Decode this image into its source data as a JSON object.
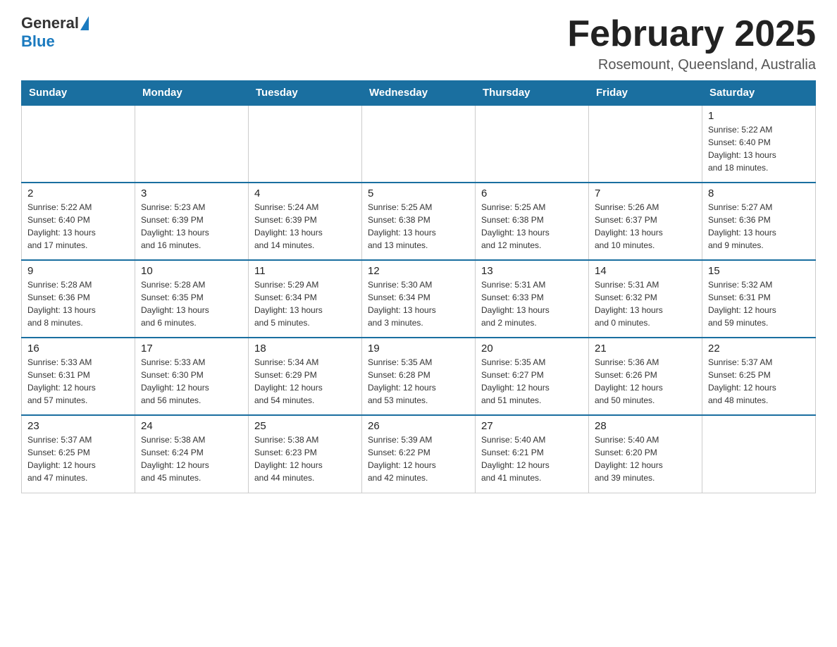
{
  "header": {
    "logo_general": "General",
    "logo_blue": "Blue",
    "month_title": "February 2025",
    "location": "Rosemount, Queensland, Australia"
  },
  "weekdays": [
    "Sunday",
    "Monday",
    "Tuesday",
    "Wednesday",
    "Thursday",
    "Friday",
    "Saturday"
  ],
  "weeks": [
    [
      {
        "day": "",
        "info": ""
      },
      {
        "day": "",
        "info": ""
      },
      {
        "day": "",
        "info": ""
      },
      {
        "day": "",
        "info": ""
      },
      {
        "day": "",
        "info": ""
      },
      {
        "day": "",
        "info": ""
      },
      {
        "day": "1",
        "info": "Sunrise: 5:22 AM\nSunset: 6:40 PM\nDaylight: 13 hours\nand 18 minutes."
      }
    ],
    [
      {
        "day": "2",
        "info": "Sunrise: 5:22 AM\nSunset: 6:40 PM\nDaylight: 13 hours\nand 17 minutes."
      },
      {
        "day": "3",
        "info": "Sunrise: 5:23 AM\nSunset: 6:39 PM\nDaylight: 13 hours\nand 16 minutes."
      },
      {
        "day": "4",
        "info": "Sunrise: 5:24 AM\nSunset: 6:39 PM\nDaylight: 13 hours\nand 14 minutes."
      },
      {
        "day": "5",
        "info": "Sunrise: 5:25 AM\nSunset: 6:38 PM\nDaylight: 13 hours\nand 13 minutes."
      },
      {
        "day": "6",
        "info": "Sunrise: 5:25 AM\nSunset: 6:38 PM\nDaylight: 13 hours\nand 12 minutes."
      },
      {
        "day": "7",
        "info": "Sunrise: 5:26 AM\nSunset: 6:37 PM\nDaylight: 13 hours\nand 10 minutes."
      },
      {
        "day": "8",
        "info": "Sunrise: 5:27 AM\nSunset: 6:36 PM\nDaylight: 13 hours\nand 9 minutes."
      }
    ],
    [
      {
        "day": "9",
        "info": "Sunrise: 5:28 AM\nSunset: 6:36 PM\nDaylight: 13 hours\nand 8 minutes."
      },
      {
        "day": "10",
        "info": "Sunrise: 5:28 AM\nSunset: 6:35 PM\nDaylight: 13 hours\nand 6 minutes."
      },
      {
        "day": "11",
        "info": "Sunrise: 5:29 AM\nSunset: 6:34 PM\nDaylight: 13 hours\nand 5 minutes."
      },
      {
        "day": "12",
        "info": "Sunrise: 5:30 AM\nSunset: 6:34 PM\nDaylight: 13 hours\nand 3 minutes."
      },
      {
        "day": "13",
        "info": "Sunrise: 5:31 AM\nSunset: 6:33 PM\nDaylight: 13 hours\nand 2 minutes."
      },
      {
        "day": "14",
        "info": "Sunrise: 5:31 AM\nSunset: 6:32 PM\nDaylight: 13 hours\nand 0 minutes."
      },
      {
        "day": "15",
        "info": "Sunrise: 5:32 AM\nSunset: 6:31 PM\nDaylight: 12 hours\nand 59 minutes."
      }
    ],
    [
      {
        "day": "16",
        "info": "Sunrise: 5:33 AM\nSunset: 6:31 PM\nDaylight: 12 hours\nand 57 minutes."
      },
      {
        "day": "17",
        "info": "Sunrise: 5:33 AM\nSunset: 6:30 PM\nDaylight: 12 hours\nand 56 minutes."
      },
      {
        "day": "18",
        "info": "Sunrise: 5:34 AM\nSunset: 6:29 PM\nDaylight: 12 hours\nand 54 minutes."
      },
      {
        "day": "19",
        "info": "Sunrise: 5:35 AM\nSunset: 6:28 PM\nDaylight: 12 hours\nand 53 minutes."
      },
      {
        "day": "20",
        "info": "Sunrise: 5:35 AM\nSunset: 6:27 PM\nDaylight: 12 hours\nand 51 minutes."
      },
      {
        "day": "21",
        "info": "Sunrise: 5:36 AM\nSunset: 6:26 PM\nDaylight: 12 hours\nand 50 minutes."
      },
      {
        "day": "22",
        "info": "Sunrise: 5:37 AM\nSunset: 6:25 PM\nDaylight: 12 hours\nand 48 minutes."
      }
    ],
    [
      {
        "day": "23",
        "info": "Sunrise: 5:37 AM\nSunset: 6:25 PM\nDaylight: 12 hours\nand 47 minutes."
      },
      {
        "day": "24",
        "info": "Sunrise: 5:38 AM\nSunset: 6:24 PM\nDaylight: 12 hours\nand 45 minutes."
      },
      {
        "day": "25",
        "info": "Sunrise: 5:38 AM\nSunset: 6:23 PM\nDaylight: 12 hours\nand 44 minutes."
      },
      {
        "day": "26",
        "info": "Sunrise: 5:39 AM\nSunset: 6:22 PM\nDaylight: 12 hours\nand 42 minutes."
      },
      {
        "day": "27",
        "info": "Sunrise: 5:40 AM\nSunset: 6:21 PM\nDaylight: 12 hours\nand 41 minutes."
      },
      {
        "day": "28",
        "info": "Sunrise: 5:40 AM\nSunset: 6:20 PM\nDaylight: 12 hours\nand 39 minutes."
      },
      {
        "day": "",
        "info": ""
      }
    ]
  ]
}
